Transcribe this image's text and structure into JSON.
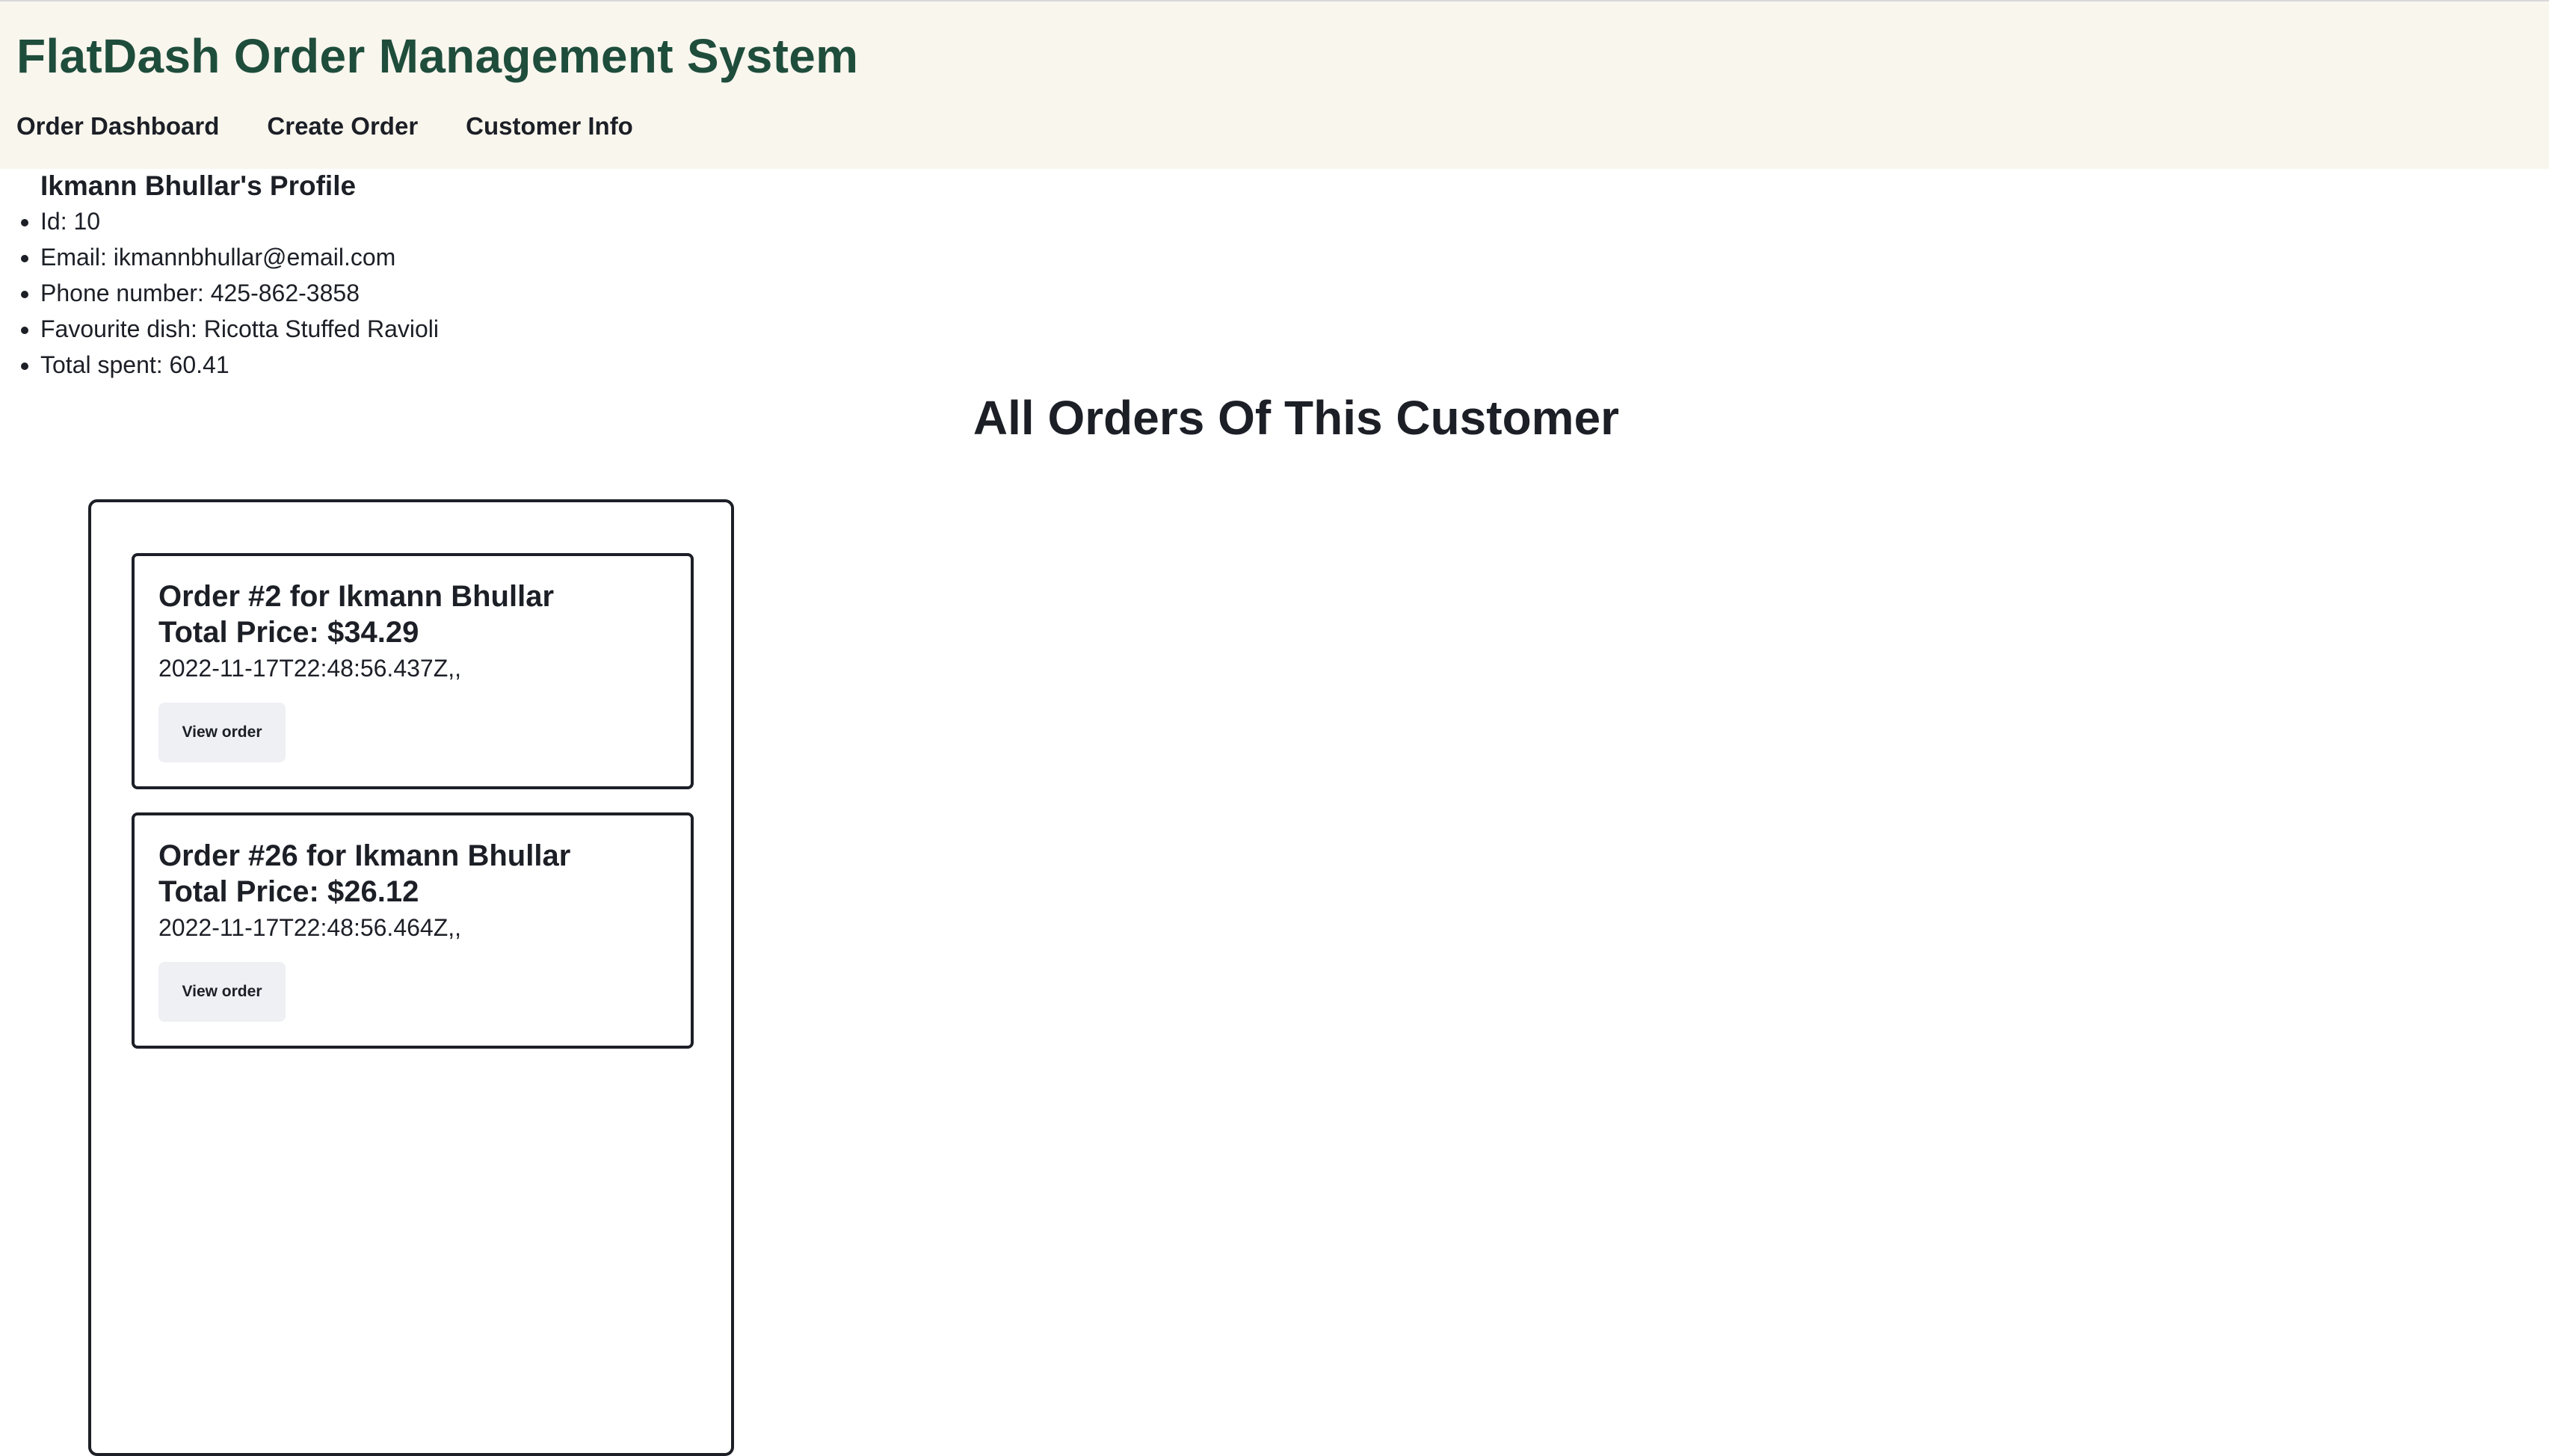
{
  "app": {
    "title": "FlatDash Order Management System"
  },
  "nav": {
    "items": [
      {
        "label": "Order Dashboard"
      },
      {
        "label": "Create Order"
      },
      {
        "label": "Customer Info"
      }
    ]
  },
  "profile": {
    "title": "Ikmann Bhullar's Profile",
    "fields": [
      "Id: 10",
      "Email: ikmannbhullar@email.com",
      "Phone number: 425-862-3858",
      "Favourite dish: Ricotta Stuffed Ravioli",
      "Total spent: 60.41"
    ]
  },
  "orders": {
    "heading": "All Orders Of This Customer",
    "items": [
      {
        "title": "Order #2 for Ikmann Bhullar",
        "price": "Total Price: $34.29",
        "date": "2022-11-17T22:48:56.437Z,,",
        "button_label": "View order"
      },
      {
        "title": "Order #26 for Ikmann Bhullar",
        "price": "Total Price: $26.12",
        "date": "2022-11-17T22:48:56.464Z,,",
        "button_label": "View order"
      }
    ]
  }
}
